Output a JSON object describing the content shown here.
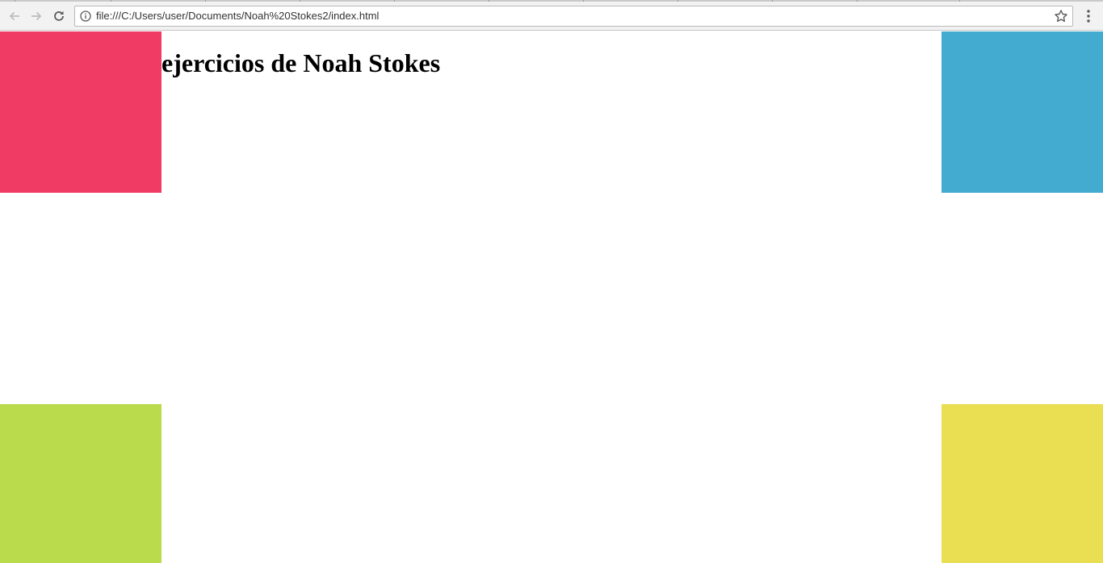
{
  "browser": {
    "address_bar": {
      "url": "file:///C:/Users/user/Documents/Noah%20Stokes2/index.html",
      "info_icon": "info-icon",
      "bookmark_icon": "star-icon"
    },
    "nav": {
      "back_icon": "arrow-left-icon",
      "forward_icon": "arrow-right-icon",
      "reload_icon": "reload-icon",
      "menu_icon": "vertical-dots-icon"
    }
  },
  "page": {
    "title": "ejercicios de Noah Stokes",
    "boxes": [
      {
        "name": "red",
        "color": "#f03c64"
      },
      {
        "name": "blue",
        "color": "#44abd0"
      },
      {
        "name": "green",
        "color": "#badb4c"
      },
      {
        "name": "yellow",
        "color": "#eade52"
      }
    ]
  }
}
